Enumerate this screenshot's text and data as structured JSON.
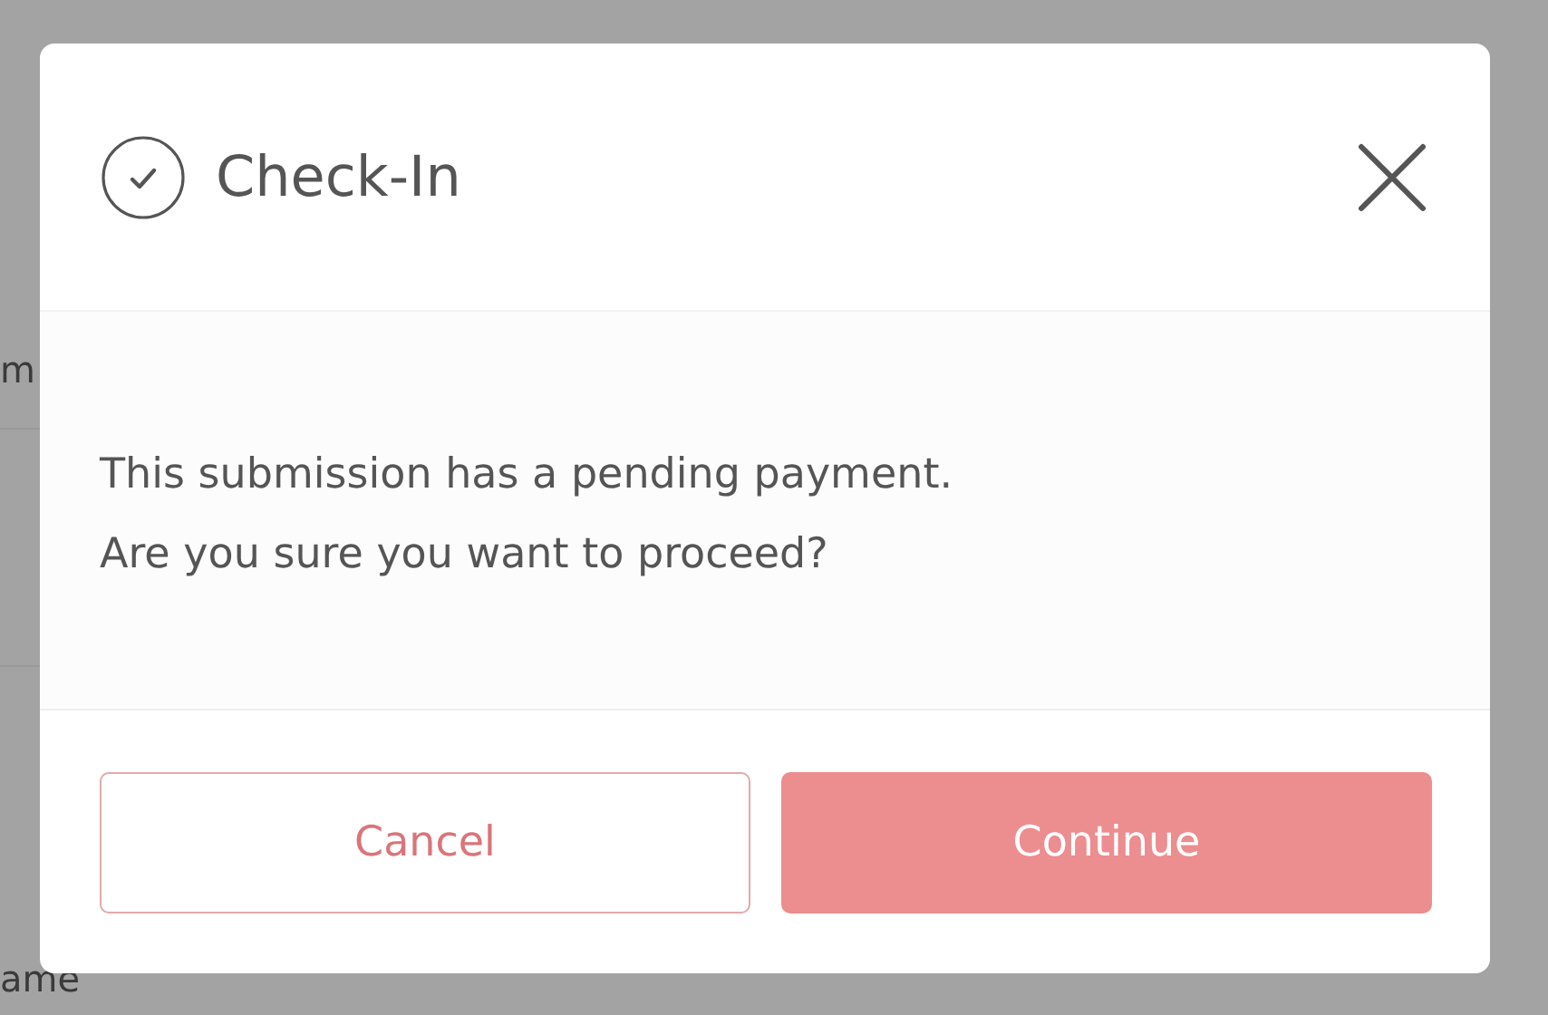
{
  "background": {
    "texts": [
      "m",
      "ame"
    ]
  },
  "dialog": {
    "title": "Check-In",
    "message_lines": [
      "This submission has a pending payment.",
      "Are you sure you want to proceed?"
    ],
    "buttons": [
      {
        "label": "Cancel",
        "kind": "secondary"
      },
      {
        "label": "Continue",
        "kind": "primary"
      }
    ]
  }
}
